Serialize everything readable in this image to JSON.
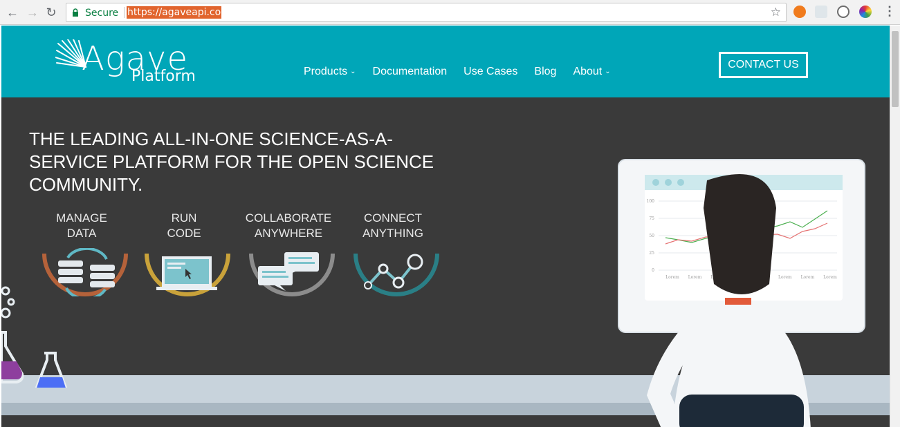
{
  "browser": {
    "secure_label": "Secure",
    "url": "https://agaveapi.co"
  },
  "site": {
    "logo_name": "Agave",
    "logo_sub": "Platform",
    "nav": [
      {
        "label": "Products",
        "has_dropdown": true
      },
      {
        "label": "Documentation",
        "has_dropdown": false
      },
      {
        "label": "Use Cases",
        "has_dropdown": false
      },
      {
        "label": "Blog",
        "has_dropdown": false
      },
      {
        "label": "About",
        "has_dropdown": true
      }
    ],
    "contact_label": "CONTACT US",
    "brand_color": "#00a6b8",
    "hero_bg": "#3a3a3a"
  },
  "hero": {
    "headline": "THE LEADING ALL-IN-ONE SCIENCE-AS-A-SERVICE PLATFORM FOR THE OPEN SCIENCE COMMUNITY.",
    "features": [
      {
        "label": "MANAGE\nDATA",
        "icon": "data-sync-icon",
        "color": "#b5623a"
      },
      {
        "label": "RUN\nCODE",
        "icon": "laptop-icon",
        "color": "#c9a23a"
      },
      {
        "label": "COLLABORATE\nANYWHERE",
        "icon": "chat-bubbles-icon",
        "color": "#8c8c8c"
      },
      {
        "label": "CONNECT\nANYTHING",
        "icon": "network-nodes-icon",
        "color": "#2a7f86"
      }
    ],
    "monitor_chart": {
      "y_ticks": [
        "100",
        "75",
        "50",
        "25",
        "0"
      ],
      "x_ticks": [
        "Lorem",
        "Lorem",
        "Lorem",
        "Lorem",
        "Lorem",
        "Lorem",
        "Lorem",
        "Lorem"
      ]
    }
  }
}
